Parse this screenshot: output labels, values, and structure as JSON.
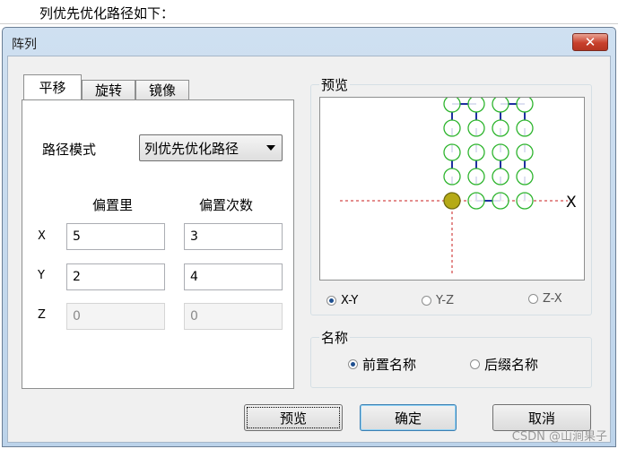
{
  "doc": {
    "caption": "列优先优化路径如下："
  },
  "window": {
    "title": "阵列",
    "close_glyph": "✕"
  },
  "tabs": [
    {
      "label": "平移",
      "active": true
    },
    {
      "label": "旋转",
      "active": false
    },
    {
      "label": "镜像",
      "active": false
    }
  ],
  "form": {
    "path_mode_label": "路径模式",
    "path_mode_value": "列优先优化路径",
    "offset_header": "偏置里",
    "count_header": "偏置次数",
    "rows": [
      {
        "axis": "X",
        "offset": "5",
        "count": "3",
        "enabled": true
      },
      {
        "axis": "Y",
        "offset": "2",
        "count": "4",
        "enabled": true
      },
      {
        "axis": "Z",
        "offset": "0",
        "count": "0",
        "enabled": false
      }
    ]
  },
  "preview": {
    "group_title": "预览",
    "axis_label": "X",
    "planes": [
      {
        "label": "X-Y",
        "selected": true
      },
      {
        "label": "Y-Z",
        "selected": false
      },
      {
        "label": "Z-X",
        "selected": false
      }
    ]
  },
  "naming": {
    "group_title": "名称",
    "options": [
      {
        "label": "前置名称",
        "selected": true
      },
      {
        "label": "后缀名称",
        "selected": false
      }
    ]
  },
  "buttons": {
    "preview": "预览",
    "ok": "确定",
    "cancel": "取消"
  },
  "watermark": "CSDN @山涧果子",
  "colors": {
    "node_outline": "#2fb52f",
    "origin_fill": "#b5aa16",
    "path_line": "#1f2fa0",
    "axis_dash": "#c81e1e"
  }
}
